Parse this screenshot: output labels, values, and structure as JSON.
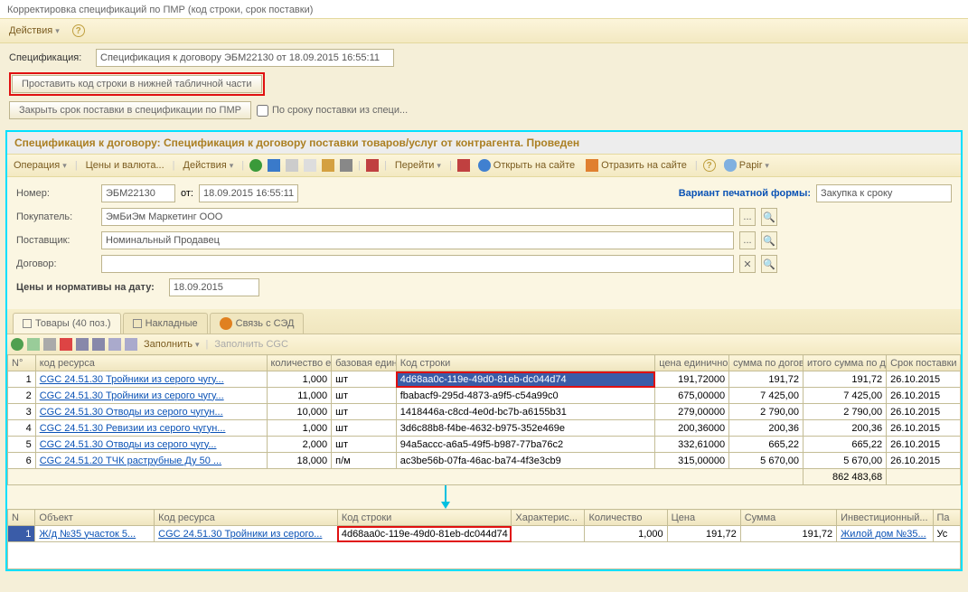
{
  "window": {
    "title": "Корректировка спецификаций по ПМР (код строки, срок поставки)"
  },
  "menu": {
    "actions": "Действия"
  },
  "spec": {
    "label": "Спецификация:",
    "value": "Спецификация к договору ЭБМ22130 от 18.09.2015 16:55:11",
    "btn_set_code": "Проставить код строки в нижней табличной части",
    "btn_close_term": "Закрыть срок поставки в спецификации по ПМР",
    "chk_term": "По сроку поставки из специ..."
  },
  "sub": {
    "title": "Спецификация к договору: Спецификация к договору поставки товаров/услуг от контрагента. Проведен",
    "tb": {
      "operation": "Операция",
      "prices": "Цены и валюта...",
      "actions": "Действия",
      "go": "Перейти",
      "open_site": "Открыть на сайте",
      "reflect_site": "Отразить на сайте",
      "papir": "Papir"
    },
    "form": {
      "number_lbl": "Номер:",
      "number": "ЭБМ22130",
      "from_lbl": "от:",
      "from": "18.09.2015 16:55:11",
      "print_variant_lbl": "Вариант печатной формы:",
      "print_variant": "Закупка к сроку",
      "buyer_lbl": "Покупатель:",
      "buyer": "ЭмБиЭм Маркетинг ООО",
      "supplier_lbl": "Поставщик:",
      "supplier": "Номинальный Продавец",
      "contract_lbl": "Договор:",
      "contract": "",
      "rates_lbl": "Цены и нормативы на дату:",
      "rates_date": "18.09.2015"
    },
    "tabs": {
      "goods": "Товары (40 поз.)",
      "invoices": "Накладные",
      "sed": "Связь с СЭД"
    },
    "gridtb": {
      "fill": "Заполнить",
      "fill_cgc": "Заполнить CGC"
    },
    "cols": {
      "n": "N°",
      "resource": "код ресурса",
      "qty": "количество единиц",
      "unit": "базовая единица",
      "rowcode": "Код строки",
      "price": "цена единичного",
      "sum_contract": "сумма по договору",
      "total_sum": "итого сумма по договору",
      "delivery": "Срок поставки"
    },
    "rows": [
      {
        "n": "1",
        "res": "CGC 24.51.30 Тройники из серого чугу...",
        "qty": "1,000",
        "unit": "шт",
        "code": "4d68aa0c-119e-49d0-81eb-dc044d74",
        "price": "191,72000",
        "sum": "191,72",
        "total": "191,72",
        "date": "26.10.2015",
        "sel": true
      },
      {
        "n": "2",
        "res": "CGC 24.51.30 Тройники из серого чугу...",
        "qty": "11,000",
        "unit": "шт",
        "code": "fbabacf9-295d-4873-a9f5-c54a99c0",
        "price": "675,00000",
        "sum": "7 425,00",
        "total": "7 425,00",
        "date": "26.10.2015"
      },
      {
        "n": "3",
        "res": "CGC 24.51.30 Отводы из серого чугун...",
        "qty": "10,000",
        "unit": "шт",
        "code": "1418446a-c8cd-4e0d-bc7b-a6155b31",
        "price": "279,00000",
        "sum": "2 790,00",
        "total": "2 790,00",
        "date": "26.10.2015"
      },
      {
        "n": "4",
        "res": "CGC 24.51.30 Ревизии из серого чугун...",
        "qty": "1,000",
        "unit": "шт",
        "code": "3d6c88b8-f4be-4632-b975-352e469e",
        "price": "200,36000",
        "sum": "200,36",
        "total": "200,36",
        "date": "26.10.2015"
      },
      {
        "n": "5",
        "res": "CGC 24.51.30 Отводы из серого чугу...",
        "qty": "2,000",
        "unit": "шт",
        "code": "94a5accc-a6a5-49f5-b987-77ba76c2",
        "price": "332,61000",
        "sum": "665,22",
        "total": "665,22",
        "date": "26.10.2015"
      },
      {
        "n": "6",
        "res": "CGC 24.51.20 ТЧК раструбные Ду 50 ...",
        "qty": "18,000",
        "unit": "п/м",
        "code": "ac3be56b-07fa-46ac-ba74-4f3e3cb9",
        "price": "315,00000",
        "sum": "5 670,00",
        "total": "5 670,00",
        "date": "26.10.2015"
      }
    ],
    "totals": {
      "total": "862 483,68"
    },
    "bottom_cols": {
      "n": "N",
      "obj": "Объект",
      "res": "Код ресурса",
      "code": "Код строки",
      "char": "Характерис...",
      "qty": "Количество",
      "price": "Цена",
      "sum": "Сумма",
      "inv": "Инвестиционный...",
      "pa": "Па"
    },
    "bottom_row": {
      "n": "1",
      "obj": "Ж/д №35 участок 5...",
      "res": "CGC 24.51.30 Тройники из серого...",
      "code": "4d68aa0c-119e-49d0-81eb-dc044d74",
      "qty": "1,000",
      "price": "191,72",
      "sum": "191,72",
      "inv": "Жилой дом №35...",
      "pa": "Ус"
    }
  }
}
